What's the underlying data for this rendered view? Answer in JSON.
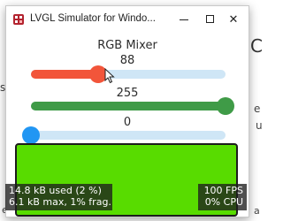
{
  "background": {
    "frag_a": "C",
    "frag_b": "s",
    "frag_c": "e",
    "frag_d": "u",
    "frag_e": "e",
    "frag_f": "a"
  },
  "window": {
    "title": "LVGL Simulator for Windo...",
    "minimize_icon": "minimize-icon",
    "maximize_icon": "maximize-icon",
    "close_symbol": "✕"
  },
  "mixer": {
    "title": "RGB Mixer",
    "sliders": [
      {
        "name": "red",
        "value_label": "88",
        "value": 88,
        "max": 255,
        "color": "#f2553a"
      },
      {
        "name": "green",
        "value_label": "255",
        "value": 255,
        "max": 255,
        "color": "#3f9b47"
      },
      {
        "name": "blue",
        "value_label": "0",
        "value": 0,
        "max": 255,
        "color": "#2196f3"
      }
    ],
    "track_color": "#cfe6f6",
    "preview_color": "#58dc00"
  },
  "perf_monitor": {
    "memory_used": "14.8 kB used (2 %)",
    "memory_max": "6.1 kB max, 1% frag.",
    "fps": "100 FPS",
    "cpu": "0% CPU"
  }
}
